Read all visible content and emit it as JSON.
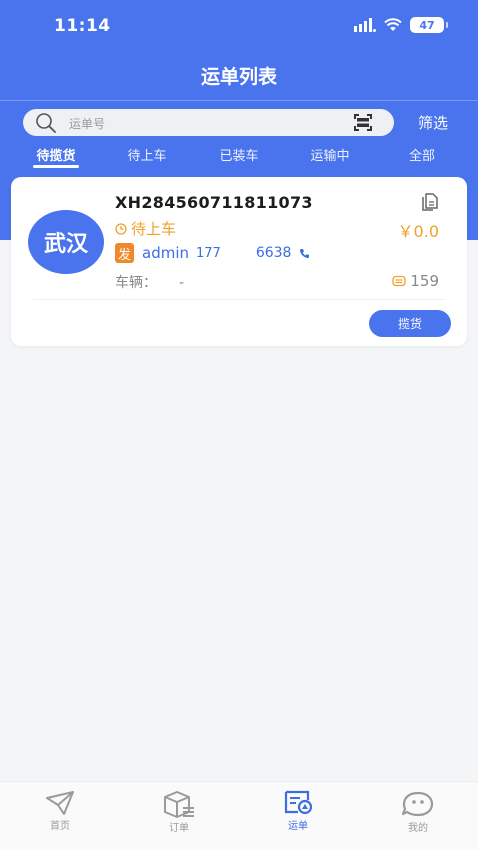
{
  "status_bar": {
    "time": "11:14",
    "battery": "47"
  },
  "nav": {
    "title": "运单列表"
  },
  "search": {
    "placeholder": "运单号",
    "filter_label": "筛选"
  },
  "tabs": [
    {
      "label": "待揽货",
      "active": true
    },
    {
      "label": "待上车",
      "active": false
    },
    {
      "label": "已装车",
      "active": false
    },
    {
      "label": "运输中",
      "active": false
    },
    {
      "label": "全部",
      "active": false
    }
  ],
  "order": {
    "city": "武汉",
    "order_no": "XH284560711811073",
    "status": "待上车",
    "price": "￥0.0",
    "shipper_badge": "发",
    "shipper_name": "admin",
    "shipper_code": "177",
    "phone": "6638",
    "vehicle_label": "车辆：",
    "vehicle_value": "-",
    "points": "159",
    "action_label": "揽货"
  },
  "tabbar": [
    {
      "label": "首页",
      "icon": "paper-plane-icon",
      "active": false
    },
    {
      "label": "订单",
      "icon": "package-icon",
      "active": false
    },
    {
      "label": "运单",
      "icon": "waybill-icon",
      "active": true
    },
    {
      "label": "我的",
      "icon": "chat-face-icon",
      "active": false
    }
  ],
  "colors": {
    "primary": "#4a74ee",
    "accent": "#f0a02c",
    "badge": "#f0892e"
  }
}
